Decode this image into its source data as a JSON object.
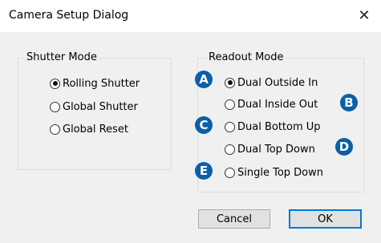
{
  "window": {
    "title": "Camera Setup Dialog",
    "close_glyph": "✕"
  },
  "shutter_mode": {
    "legend": "Shutter Mode",
    "options": [
      {
        "label": "Rolling Shutter",
        "checked": true
      },
      {
        "label": "Global Shutter",
        "checked": false
      },
      {
        "label": "Global Reset",
        "checked": false
      }
    ]
  },
  "readout_mode": {
    "legend": "Readout Mode",
    "options": [
      {
        "label": "Dual Outside In",
        "checked": true
      },
      {
        "label": "Dual Inside Out",
        "checked": false
      },
      {
        "label": "Dual Bottom Up",
        "checked": false
      },
      {
        "label": "Dual Top Down",
        "checked": false
      },
      {
        "label": "Single Top Down",
        "checked": false
      }
    ]
  },
  "callouts": {
    "a": "A",
    "b": "B",
    "c": "C",
    "d": "D",
    "e": "E",
    "color": "#0b5fa8"
  },
  "buttons": {
    "cancel": "Cancel",
    "ok": "OK"
  }
}
